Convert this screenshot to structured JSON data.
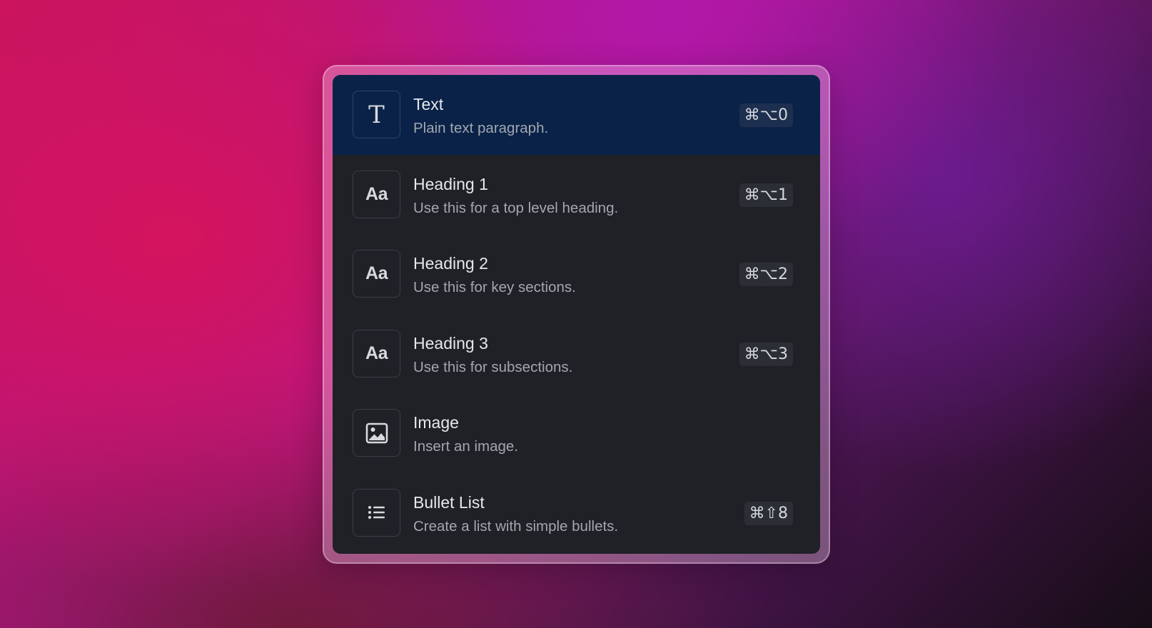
{
  "menu": {
    "items": [
      {
        "title": "Text",
        "description": "Plain text paragraph.",
        "shortcut": "⌘⌥0",
        "icon": "text-icon",
        "active": true
      },
      {
        "title": "Heading 1",
        "description": "Use this for a top level heading.",
        "shortcut": "⌘⌥1",
        "icon": "heading-icon",
        "icon_text": "Aa"
      },
      {
        "title": "Heading 2",
        "description": "Use this for key sections.",
        "shortcut": "⌘⌥2",
        "icon": "heading-icon",
        "icon_text": "Aa"
      },
      {
        "title": "Heading 3",
        "description": "Use this for subsections.",
        "shortcut": "⌘⌥3",
        "icon": "heading-icon",
        "icon_text": "Aa"
      },
      {
        "title": "Image",
        "description": "Insert an image.",
        "shortcut": "",
        "icon": "image-icon"
      },
      {
        "title": "Bullet List",
        "description": "Create a list with simple bullets.",
        "shortcut": "⌘⇧8",
        "icon": "bullet-list-icon"
      }
    ],
    "text_icon_glyph": "T"
  },
  "colors": {
    "menu_background": "#1f2126",
    "active_background": "#0a2248",
    "title_text": "#e6e8eb",
    "description_text": "#a2a7af"
  }
}
